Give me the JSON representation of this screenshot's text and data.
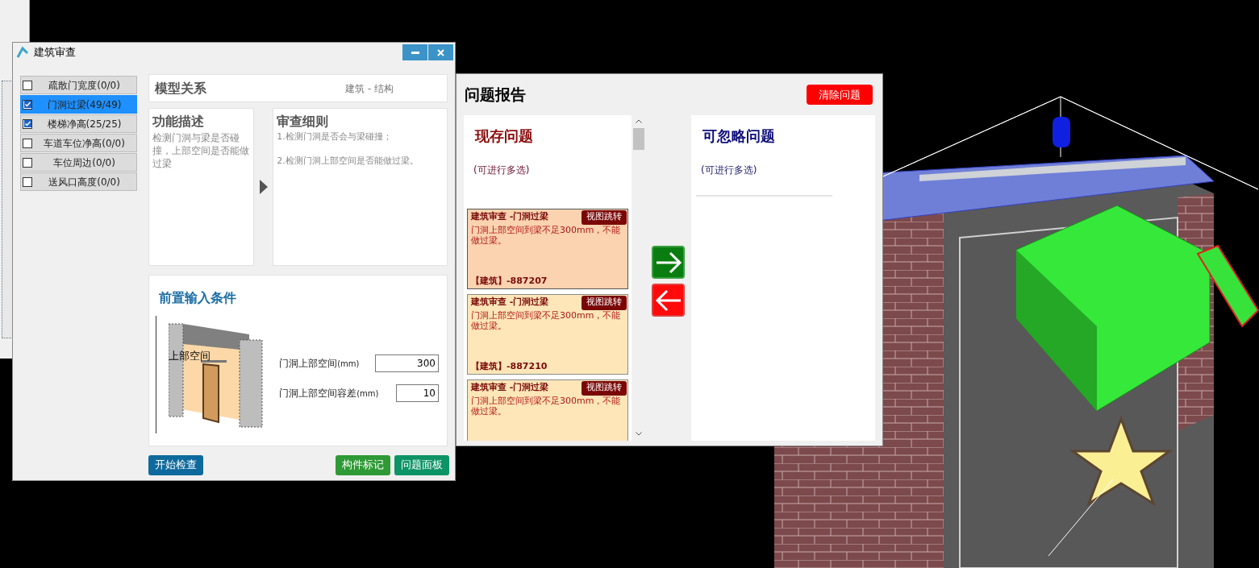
{
  "dialog": {
    "title": "建筑审查",
    "checks": [
      {
        "label": "疏散门宽度(0/0)",
        "checked": false,
        "selected": false
      },
      {
        "label": "门洞过梁(49/49)",
        "checked": true,
        "selected": true
      },
      {
        "label": "楼梯净高(25/25)",
        "checked": true,
        "selected": false
      },
      {
        "label": "车道车位净高(0/0)",
        "checked": false,
        "selected": false
      },
      {
        "label": "车位周边(0/0)",
        "checked": false,
        "selected": false
      },
      {
        "label": "送风口高度(0/0)",
        "checked": false,
        "selected": false
      }
    ],
    "model_relation": {
      "title": "模型关系",
      "subtitle": "建筑 - 结构"
    },
    "function": {
      "title": "功能描述",
      "text": "检测门洞与梁是否碰撞，上部空间是否能做过梁"
    },
    "rules": {
      "title": "审查细则",
      "lines": [
        "1.检测门洞是否会与梁碰撞；",
        "2.检测门洞上部空间是否能做过梁。"
      ]
    },
    "preconditions": {
      "title": "前置输入条件",
      "diagram_label": "上部空间",
      "fields": [
        {
          "label": "门洞上部空间",
          "unit": "(mm)",
          "value": "300"
        },
        {
          "label": "门洞上部空间容差",
          "unit": "(mm)",
          "value": "10"
        }
      ]
    },
    "buttons": [
      {
        "label": "开始检查",
        "color": "#0e6a9c"
      },
      {
        "label": "构件标记",
        "color": "#2f9a35"
      },
      {
        "label": "问题面板",
        "color": "#0d9466"
      }
    ]
  },
  "report": {
    "title": "问题报告",
    "clear_button": "清除问题",
    "current": {
      "title": "现存问题",
      "hint": "(可进行多选)",
      "issues": [
        {
          "title": "建筑审查 -门洞过梁",
          "jump": "视图跳转",
          "text": "门洞上部空间到梁不足300mm，不能做过梁。",
          "id": "【建筑】-887207",
          "selected": true
        },
        {
          "title": "建筑审查 -门洞过梁",
          "jump": "视图跳转",
          "text": "门洞上部空间到梁不足300mm，不能做过梁。",
          "id": "【建筑】-887210",
          "selected": false
        },
        {
          "title": "建筑审查 -门洞过梁",
          "jump": "视图跳转",
          "text": "门洞上部空间到梁不足300mm，不能做过梁。",
          "selected": false
        }
      ]
    },
    "ignorable": {
      "title": "可忽略问题",
      "hint": "(可进行多选)"
    }
  }
}
